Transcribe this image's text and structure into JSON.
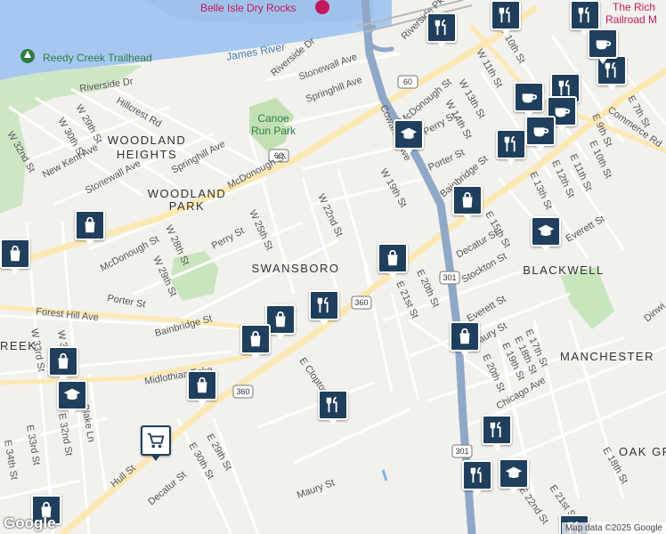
{
  "map": {
    "neighborhoods": [
      "WOODLAND",
      "HEIGHTS",
      "WOODLAND",
      "PARK",
      "SWANSBORO",
      "BLACKWELL",
      "MANCHESTER",
      "OAK GROV",
      "REEK"
    ],
    "parks": [
      "Reedy Creek Trailhead",
      "Canoe",
      "Run Park"
    ],
    "water": [
      "James River"
    ],
    "pois": [
      "Belle Isle Dry Rocks",
      "The Rich",
      "Railroad M"
    ],
    "streets": [
      "Riverside Dr",
      "Riverside Dr",
      "Stonewall Ave",
      "Springhill Ave",
      "Hillcrest Rd",
      "W 29th St",
      "W 30th St",
      "W 32nd St",
      "New Kent Ave",
      "Stonewall Ave",
      "Springhill Ave",
      "McDonough St",
      "W 25th St",
      "W 22nd St",
      "Perry St",
      "W 28th St",
      "W 29th St",
      "McDonough St",
      "Porter St",
      "Bainbridge St",
      "Forest Hill Ave",
      "Midlothian Tpke",
      "W 33rd St",
      "W 32nd St",
      "Blake Ln",
      "E 32nd St",
      "E 33rd St",
      "E 34th St",
      "Hull St",
      "E 29th St",
      "E 30th St",
      "Decatur St",
      "Maury St",
      "E Clopton St",
      "E 20th St",
      "E 21st St",
      "W 19th St",
      "Cowardin Ave",
      "Porter St",
      "McDonough St",
      "Perry St",
      "Bainbridge St",
      "W 14th St",
      "W 13th St",
      "W 11th St",
      "W 10th St",
      "Riverside Pkwy",
      "Decatur St",
      "Stockton St",
      "E 15th St",
      "E 13th St",
      "E 12th St",
      "E 11th St",
      "E 10th St",
      "E 9th St",
      "E 7th St",
      "Commerce Rd",
      "Everett St",
      "Everett St",
      "Maury St",
      "E 17th St",
      "E 18th St",
      "E 19th St",
      "E 20th St",
      "Chicago Ave",
      "E 22nd St",
      "E 21st St",
      "E 18th St",
      "Dinwi"
    ],
    "shields": [
      "60",
      "60",
      "360",
      "360",
      "301",
      "301"
    ],
    "attribution": "Map data ©2025 Google",
    "google_logo": "Google",
    "marker_icons": [
      "shopping-bag",
      "restaurant",
      "cafe",
      "school",
      "grocery-cart"
    ]
  }
}
